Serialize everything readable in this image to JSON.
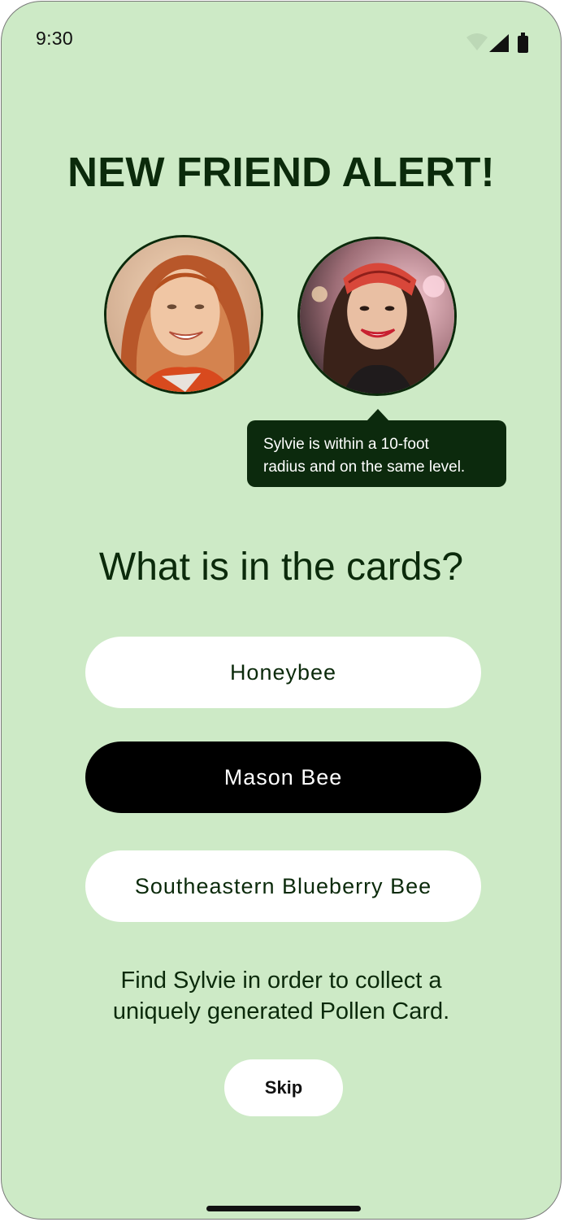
{
  "status_bar": {
    "time": "9:30",
    "icons": [
      "wifi-icon",
      "signal-icon",
      "battery-icon"
    ]
  },
  "title": "NEW FRIEND ALERT!",
  "avatars": [
    {
      "name": "avatar-redhead-woman"
    },
    {
      "name": "avatar-sylvie"
    }
  ],
  "tooltip": {
    "line1": "Sylvie is within a 10-foot",
    "line2": "radius and on the same level."
  },
  "question": "What is in the cards?",
  "options": [
    {
      "label": "Honeybee",
      "selected": false
    },
    {
      "label": "Mason Bee",
      "selected": true
    },
    {
      "label": "Southeastern Blueberry Bee",
      "selected": false
    }
  ],
  "info": {
    "line1": "Find Sylvie in order to collect a",
    "line2": "uniquely generated Pollen Card."
  },
  "skip_label": "Skip",
  "colors": {
    "background": "#cdeac6",
    "dark_green": "#0b2a0b",
    "selected_bg": "#000000",
    "option_bg": "#ffffff"
  }
}
